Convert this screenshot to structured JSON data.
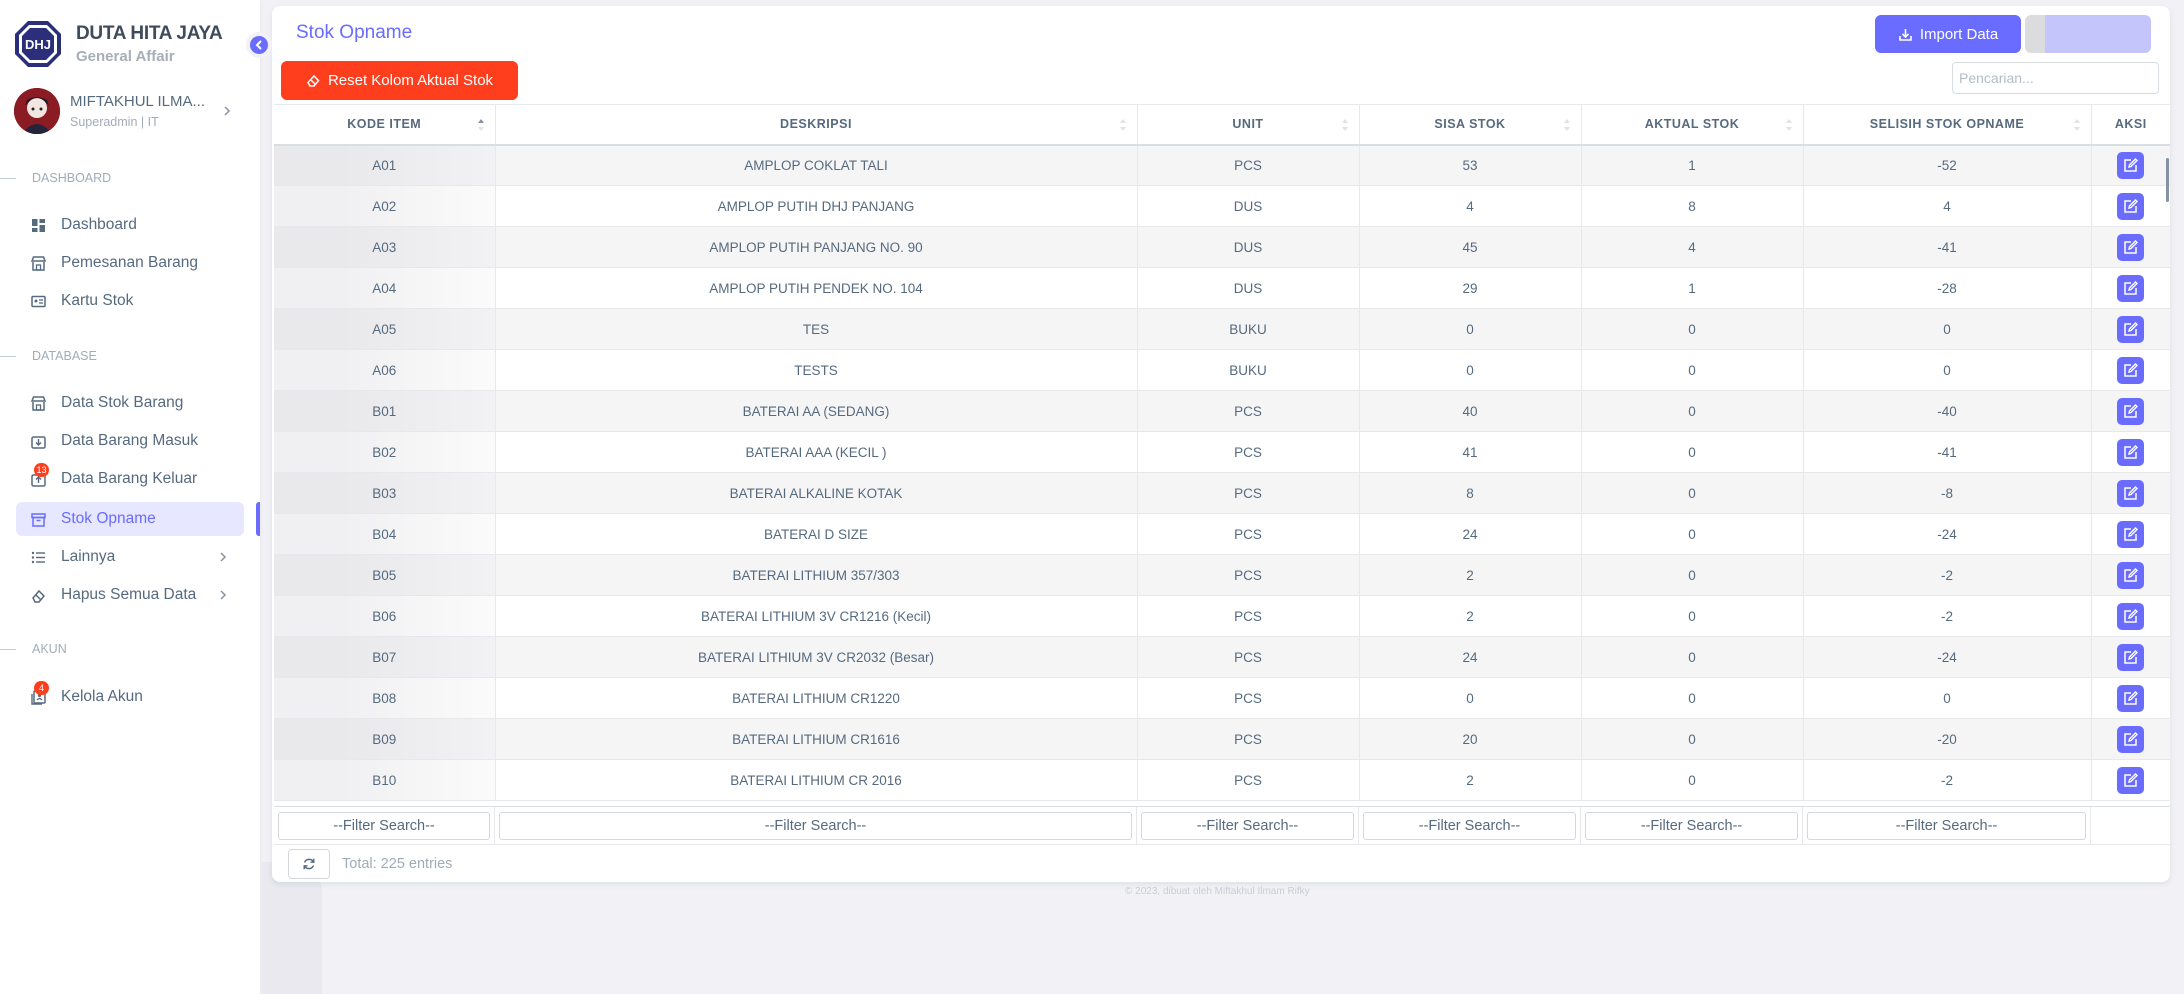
{
  "brand": {
    "logo_text": "DHJ",
    "title": "DUTA HITA JAYA",
    "subtitle": "General Affair"
  },
  "user": {
    "name": "MIFTAKHUL ILMA...",
    "role": "Superadmin | IT"
  },
  "sections": {
    "dashboard": "DASHBOARD",
    "database": "DATABASE",
    "akun": "AKUN"
  },
  "nav": {
    "dashboard": "Dashboard",
    "pemesanan": "Pemesanan Barang",
    "kartu_stok": "Kartu Stok",
    "data_stok": "Data Stok Barang",
    "barang_masuk": "Data Barang Masuk",
    "barang_keluar": "Data Barang Keluar",
    "barang_keluar_badge": "13",
    "stok_opname": "Stok Opname",
    "lainnya": "Lainnya",
    "hapus_semua": "Hapus Semua Data",
    "kelola_akun": "Kelola Akun",
    "kelola_akun_badge": "4"
  },
  "page": {
    "title": "Stok Opname",
    "import_label": "Import Data",
    "reset_label": "Reset Kolom Aktual Stok",
    "search_placeholder": "Pencarian..."
  },
  "table": {
    "headers": [
      "KODE ITEM",
      "DESKRIPSI",
      "UNIT",
      "SISA STOK",
      "AKTUAL STOK",
      "SELISIH STOK OPNAME",
      "AKSI"
    ],
    "rows": [
      [
        "A01",
        "AMPLOP COKLAT TALI",
        "PCS",
        "53",
        "1",
        "-52"
      ],
      [
        "A02",
        "AMPLOP PUTIH DHJ PANJANG",
        "DUS",
        "4",
        "8",
        "4"
      ],
      [
        "A03",
        "AMPLOP PUTIH PANJANG NO. 90",
        "DUS",
        "45",
        "4",
        "-41"
      ],
      [
        "A04",
        "AMPLOP PUTIH PENDEK NO. 104",
        "DUS",
        "29",
        "1",
        "-28"
      ],
      [
        "A05",
        "TES",
        "BUKU",
        "0",
        "0",
        "0"
      ],
      [
        "A06",
        "TESTS",
        "BUKU",
        "0",
        "0",
        "0"
      ],
      [
        "B01",
        "BATERAI AA (SEDANG)",
        "PCS",
        "40",
        "0",
        "-40"
      ],
      [
        "B02",
        "BATERAI AAA (KECIL )",
        "PCS",
        "41",
        "0",
        "-41"
      ],
      [
        "B03",
        "BATERAI ALKALINE KOTAK",
        "PCS",
        "8",
        "0",
        "-8"
      ],
      [
        "B04",
        "BATERAI D SIZE",
        "PCS",
        "24",
        "0",
        "-24"
      ],
      [
        "B05",
        "BATERAI LITHIUM 357/303",
        "PCS",
        "2",
        "0",
        "-2"
      ],
      [
        "B06",
        "BATERAI LITHIUM 3V CR1216 (Kecil)",
        "PCS",
        "2",
        "0",
        "-2"
      ],
      [
        "B07",
        "BATERAI LITHIUM 3V CR2032 (Besar)",
        "PCS",
        "24",
        "0",
        "-24"
      ],
      [
        "B08",
        "BATERAI LITHIUM CR1220",
        "PCS",
        "0",
        "0",
        "0"
      ],
      [
        "B09",
        "BATERAI LITHIUM CR1616",
        "PCS",
        "20",
        "0",
        "-20"
      ],
      [
        "B10",
        "BATERAI LITHIUM CR 2016",
        "PCS",
        "2",
        "0",
        "-2"
      ]
    ],
    "filter_placeholder": "--Filter Search--",
    "total": "Total: 225 entries"
  },
  "footer": {
    "copyright": "© 2023, dibuat oleh Miftakhul Ilmam Rifky"
  },
  "colors": {
    "primary": "#696cff",
    "danger": "#ff3e1d"
  }
}
